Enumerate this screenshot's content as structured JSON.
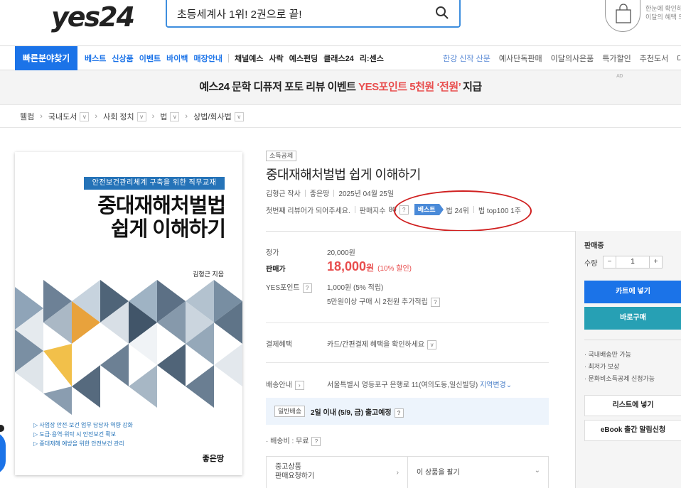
{
  "header": {
    "logo": "yes24",
    "search_value": "초등세계사 1위! 2권으로 끝!",
    "cart_text_line1": "한눈에 확인하",
    "cart_text_line2": "이달의 혜택 도"
  },
  "nav": {
    "quick_find": "빠른분야찾기",
    "left_items": [
      "베스트",
      "신상품",
      "이벤트",
      "바이백",
      "매장안내"
    ],
    "left_items_dark": [
      "채널예스",
      "사락",
      "예스펀딩",
      "클래스24",
      "리:센스"
    ],
    "right_items": [
      "한강 신작 산문",
      "예사단독판매",
      "이달의사은품",
      "특가할인",
      "추천도서",
      "대랑"
    ]
  },
  "banner": {
    "text_main": "예스24 문학 디퓨저 포토 리뷰 이벤트 ",
    "text_highlight": "YES포인트 5천원 ‘전원’",
    "text_end": " 지급",
    "ad_label": "AD"
  },
  "breadcrumb": [
    "웰컴",
    "국내도서",
    "사회 정치",
    "법",
    "상법/회사법"
  ],
  "cover": {
    "tagline": "안전보건관리체계 구축을 위한 직무교재",
    "title_line1": "중대재해처벌법",
    "title_line2": "쉽게 이해하기",
    "author": "김형근 지음",
    "bullets": [
      "▷ 사업장 안전·보건 업무 담당자 역량 강화",
      "▷ 도급·용역·위탁 시 안전보건 확보",
      "▷ 중대재해 예방을 위한 안전보건 관리"
    ],
    "publisher": "좋은땅"
  },
  "product": {
    "badge": "소득공제",
    "title": "중대재해처벌법 쉽게 이해하기",
    "author": "김형근 작사",
    "publisher": "좋은땅",
    "date": "2025년 04월 25일",
    "review_prompt": "첫번째 리뷰어가 되어주세요.",
    "sales_index_label": "판매지수",
    "sales_index": "80",
    "best_label": "베스트",
    "rank1": "법 24위",
    "rank2": "법 top100 1주"
  },
  "price": {
    "list_label": "정가",
    "list_value": "20,000원",
    "sale_label": "판매가",
    "sale_value": "18,000",
    "sale_unit": "원",
    "discount": "(10% 할인)",
    "points_label": "YES포인트",
    "points_value": "1,000원 (5% 적립)",
    "points_extra": "5만원이상 구매 시 2천원 추가적립",
    "payment_label": "결제혜택",
    "payment_value": "카드/간편결제 혜택을 확인하세요",
    "shipping_label": "배송안내",
    "shipping_address": "서울특별시 영등포구 은행로 11(여의도동,일신빌딩)",
    "region_change": "지역변경",
    "ship_tag": "일반배송",
    "ship_eta": "2일 이내 (5/9, 금) 출고예정",
    "fee": "· 배송비 : 무료",
    "used_line1": "중고상품",
    "used_line2": "판매요청하기",
    "sell_this": "이 상품을 팔기"
  },
  "side": {
    "status": "판매중",
    "qty_label": "수량",
    "qty_value": "1",
    "cart_btn": "카트에 넣기",
    "buy_btn": "바로구매",
    "notes": [
      "· 국내배송만 가능",
      "· 최저가 보상",
      "· 문화비소득공제 신청가능"
    ],
    "list_btn": "리스트에 넣기",
    "ebook_btn": "eBook 출간 알림신청"
  },
  "colors": {
    "brand_blue": "#1b73e8",
    "price_red": "#e84d4d",
    "annotation_red": "#d02020",
    "buy_teal": "#27a0b4"
  }
}
